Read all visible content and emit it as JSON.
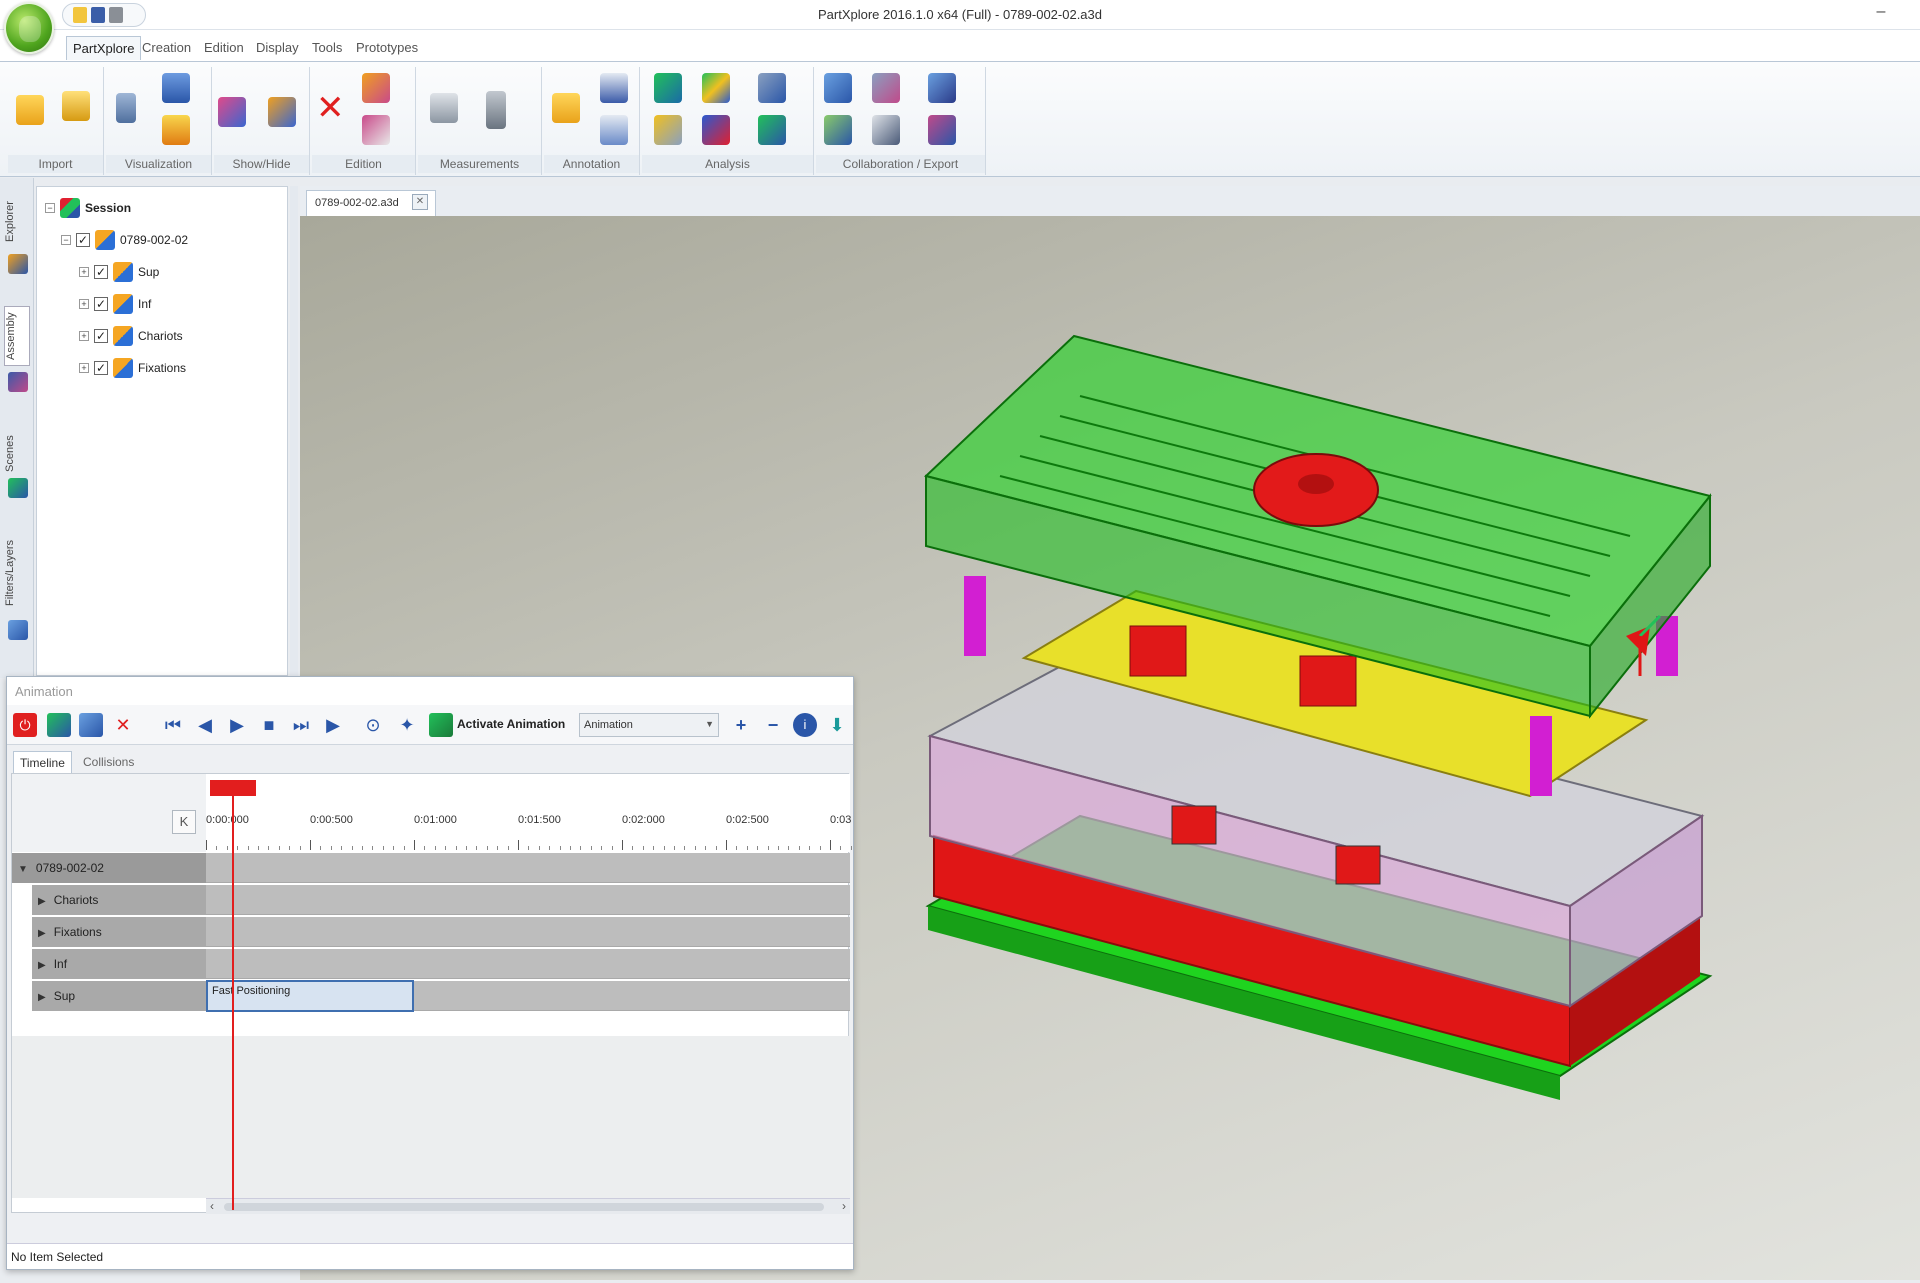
{
  "window": {
    "title": "PartXplore 2016.1.0 x64 (Full) - 0789-002-02.a3d",
    "minimize": "–"
  },
  "ribbon": {
    "tabs": [
      "PartXplore",
      "Creation",
      "Edition",
      "Display",
      "Tools",
      "Prototypes"
    ],
    "active_tab": "PartXplore",
    "groups": [
      "Import",
      "Visualization",
      "Show/Hide",
      "Edition",
      "Measurements",
      "Annotation",
      "Analysis",
      "Collaboration / Export"
    ]
  },
  "side_tabs": [
    "Explorer",
    "Assembly",
    "Scenes",
    "Filters/Layers"
  ],
  "tree": {
    "root": "Session",
    "assembly": "0789-002-02",
    "children": [
      "Sup",
      "Inf",
      "Chariots",
      "Fixations"
    ]
  },
  "document_tab": "0789-002-02.a3d",
  "animation": {
    "title": "Animation",
    "activate_label": "Activate Animation",
    "select_value": "Animation",
    "tabs": [
      "Timeline",
      "Collisions"
    ],
    "k_button": "K",
    "ruler_labels": [
      "0:00:000",
      "0:00:500",
      "0:01:000",
      "0:01:500",
      "0:02:000",
      "0:02:500",
      "0:03"
    ],
    "assembly_row": "0789-002-02",
    "rows": [
      "Chariots",
      "Fixations",
      "Inf",
      "Sup"
    ],
    "clip": {
      "row": "Sup",
      "label": "Fast Positioning"
    },
    "status": "No Item Selected"
  },
  "colors": {
    "accent": "#3f6fb0",
    "playhead": "#e21e1e",
    "mold_top": "#2fcc2f",
    "mold_plate": "#e8e02a",
    "mold_bottom": "#e01919",
    "mold_base": "#2fbf2f"
  }
}
